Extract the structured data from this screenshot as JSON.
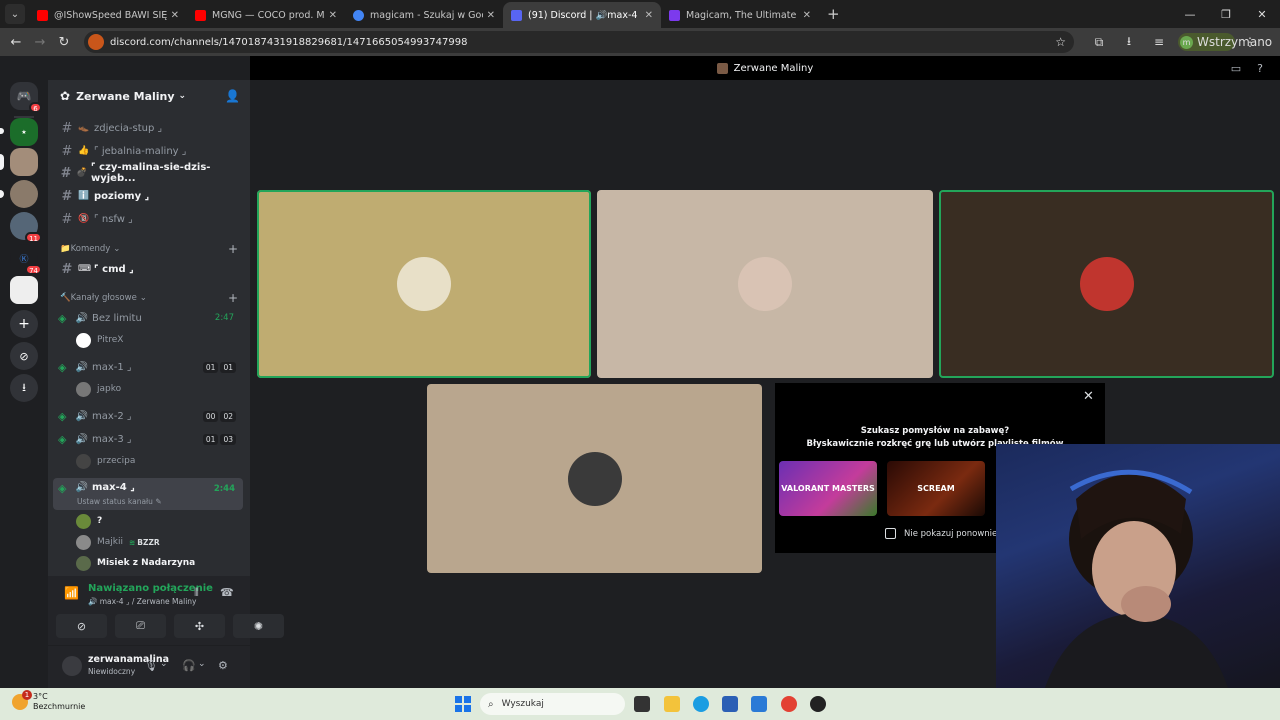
{
  "browser": {
    "tabs": [
      {
        "label": "@IShowSpeed BAWI SIĘ W WA...",
        "color": "#ff0000",
        "active": false
      },
      {
        "label": "MGNG — COCO prod. MRGH ...",
        "color": "#ff0000",
        "active": false
      },
      {
        "label": "magicam - Szukaj w Google",
        "color": "#4285f4",
        "active": false
      },
      {
        "label": "(91) Discord | 🔊max-4 ...",
        "color": "#5865f2",
        "active": true
      },
      {
        "label": "Magicam, The Ultimate Real-Tim...",
        "color": "#7c3aed",
        "active": false
      }
    ],
    "url": "discord.com/channels/1470187431918829681/1471665054993747998",
    "profile_label": "Wstrzymano",
    "profile_initial": "m"
  },
  "discord": {
    "call_title": "Zerwane Maliny",
    "server_name": "Zerwane Maliny",
    "guild_badges": [
      "6",
      "11",
      "74"
    ],
    "channels": [
      {
        "emoji": "👞",
        "name": "zdjecia-stup ⌟",
        "bright": false
      },
      {
        "emoji": "👍",
        "name": "⌜ jebalnia-maliny ⌟",
        "bright": false
      },
      {
        "emoji": "💣",
        "name": "⌜ czy-malina-sie-dzis-wyjeb...",
        "bright": true
      },
      {
        "emoji": "ℹ️",
        "name": "poziomy ⌟",
        "bright": true
      },
      {
        "emoji": "🔞",
        "name": "⌜ nsfw ⌟",
        "bright": false
      }
    ],
    "category_commands": "Komendy",
    "cmd_channel": {
      "emoji": "⌨",
      "name": "⌜ cmd ⌟"
    },
    "category_voice": "Kanały głosowe",
    "voice_channels": [
      {
        "name": "Bez limitu",
        "timer": "2:47",
        "limit": null
      },
      {
        "name": "max-1 ⌟",
        "timer": null,
        "limit": [
          "01",
          "01"
        ]
      },
      {
        "name": "max-2 ⌟",
        "timer": null,
        "limit": [
          "00",
          "02"
        ]
      },
      {
        "name": "max-3 ⌟",
        "timer": null,
        "limit": [
          "01",
          "03"
        ]
      },
      {
        "name": "max-4 ⌟",
        "timer": "2:44",
        "limit": null
      }
    ],
    "voice_users": {
      "bez_limitu": [
        "PitreX"
      ],
      "max1": [
        "japko"
      ],
      "max3": [
        "przecipa"
      ],
      "max4": [
        "?",
        "Majkii",
        "Misiek z Nadarzyna"
      ]
    },
    "max4_status": "Ustaw status kanału",
    "majkii_tag": "BZZR",
    "connection": {
      "title": "Nawiązano połączenie",
      "subtitle": "🔊 max-4 ⌟ / Zerwane Maliny"
    },
    "user_panel": {
      "name": "zerwanamalina",
      "status": "Niewidoczny"
    },
    "promo": {
      "title": "Szukasz pomysłów na zabawę?",
      "subtitle": "Błyskawicznie rozkręć grę lub utwórz playlistę filmów",
      "card1": "VALORANT MASTERS",
      "card2": "SCREAM",
      "checkbox": "Nie pokazuj ponownie"
    },
    "colors": {
      "speaking": "#23a55a",
      "accent": "#5865f2"
    }
  },
  "taskbar": {
    "weather_temp": "3°C",
    "weather_desc": "Bezchmurnie",
    "weather_badge": "1",
    "search_placeholder": "Wyszukaj"
  }
}
